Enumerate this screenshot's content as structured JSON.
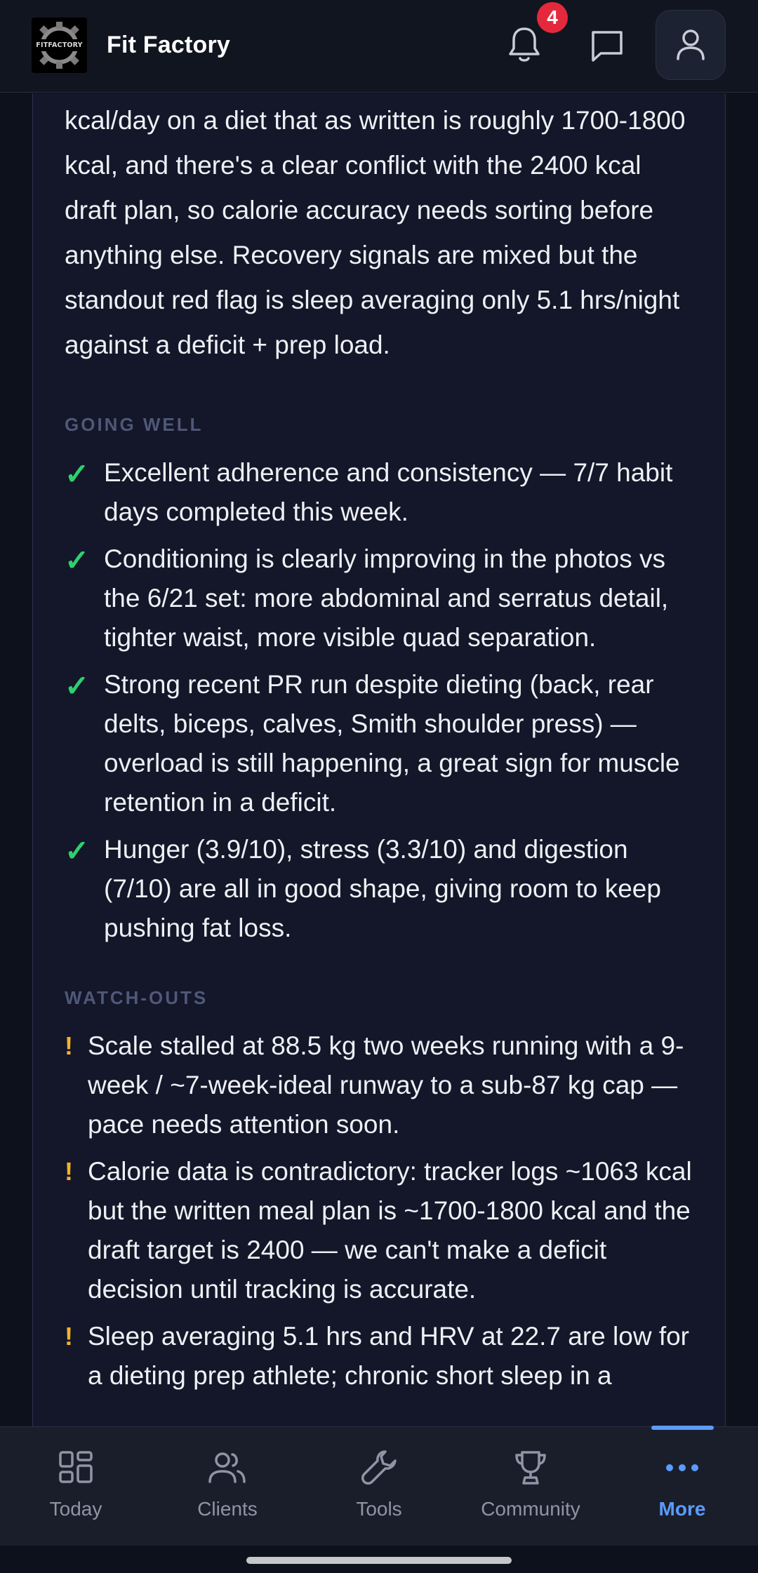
{
  "header": {
    "logo_text": "FITFACTORY",
    "app_title": "Fit Factory",
    "notification_count": "4"
  },
  "summary_text": "kcal/day on a diet that as written is roughly 1700-1800 kcal, and there's a clear conflict with the 2400 kcal draft plan, so calorie accuracy needs sorting before anything else. Recovery signals are mixed but the standout red flag is sleep averaging only 5.1 hrs/night against a deficit + prep load.",
  "going_well": {
    "label": "GOING WELL",
    "marker": "✓",
    "items": [
      "Excellent adherence and consistency — 7/7 habit days completed this week.",
      "Conditioning is clearly improving in the photos vs the 6/21 set: more abdominal and serratus detail, tighter waist, more visible quad separation.",
      "Strong recent PR run despite dieting (back, rear delts, biceps, calves, Smith shoulder press) — overload is still happening, a great sign for muscle retention in a deficit.",
      "Hunger (3.9/10), stress (3.3/10) and digestion (7/10) are all in good shape, giving room to keep pushing fat loss."
    ]
  },
  "watch_outs": {
    "label": "WATCH-OUTS",
    "marker": "!",
    "items": [
      "Scale stalled at 88.5 kg two weeks running with a 9-week / ~7-week-ideal runway to a sub-87 kg cap — pace needs attention soon.",
      "Calorie data is contradictory: tracker logs ~1063 kcal but the written meal plan is ~1700-1800 kcal and the draft target is 2400 — we can't make a deficit decision until tracking is accurate.",
      "Sleep averaging 5.1 hrs and HRV at 22.7 are low for a dieting prep athlete; chronic short sleep in a"
    ]
  },
  "bottom_nav": {
    "items": [
      {
        "label": "Today",
        "icon": "grid-icon"
      },
      {
        "label": "Clients",
        "icon": "users-icon"
      },
      {
        "label": "Tools",
        "icon": "wrench-icon"
      },
      {
        "label": "Community",
        "icon": "trophy-icon"
      },
      {
        "label": "More",
        "icon": "more-dots-icon"
      }
    ],
    "active": "More"
  },
  "colors": {
    "accent": "#5b9bff",
    "success": "#2ed06e",
    "warning": "#f3b32a",
    "badge": "#e5293c"
  }
}
